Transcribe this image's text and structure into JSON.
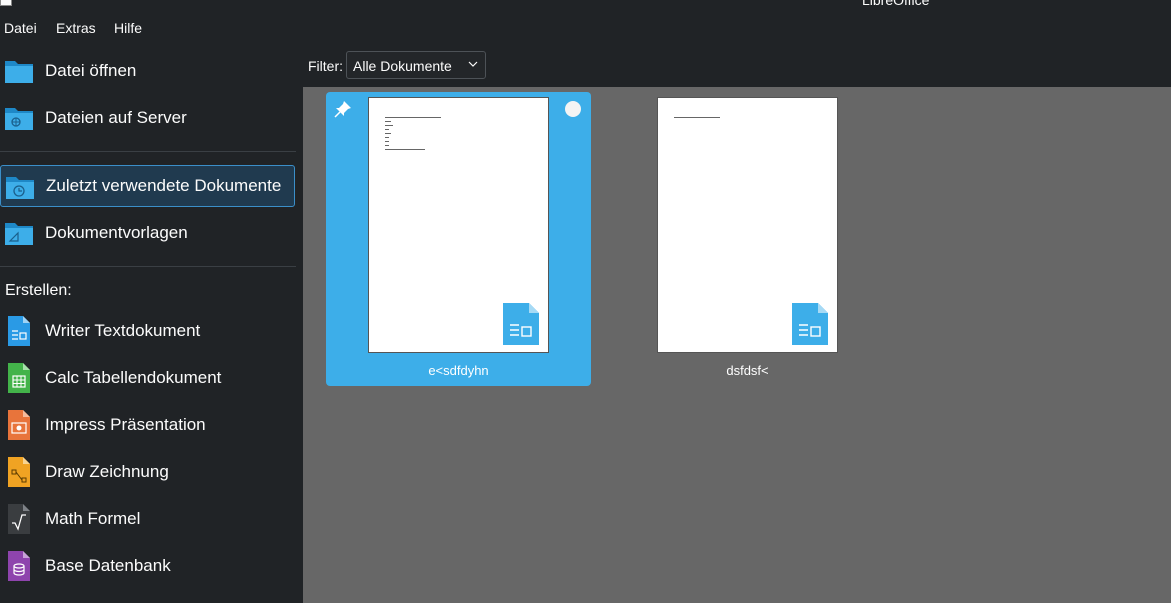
{
  "window": {
    "title": "LibreOffice"
  },
  "menubar": {
    "items": [
      "Datei",
      "Extras",
      "Hilfe"
    ]
  },
  "sidebar": {
    "nav": [
      {
        "label": "Datei öffnen",
        "icon": "folder-icon"
      },
      {
        "label": "Dateien auf Server",
        "icon": "folder-remote-icon"
      },
      {
        "label": "Zuletzt verwendete Dokumente",
        "icon": "folder-recent-icon",
        "active": true
      },
      {
        "label": "Dokumentvorlagen",
        "icon": "folder-templates-icon"
      }
    ],
    "create_heading": "Erstellen:",
    "create": [
      {
        "label": "Writer Textdokument",
        "icon": "writer-icon",
        "color": "#2a9ae5"
      },
      {
        "label": "Calc Tabellendokument",
        "icon": "calc-icon",
        "color": "#43b34a"
      },
      {
        "label": "Impress Präsentation",
        "icon": "impress-icon",
        "color": "#e8743b"
      },
      {
        "label": "Draw Zeichnung",
        "icon": "draw-icon",
        "color": "#f0a323"
      },
      {
        "label": "Math Formel",
        "icon": "math-icon",
        "color": "#3a3d40"
      },
      {
        "label": "Base Datenbank",
        "icon": "base-icon",
        "color": "#8e44ad"
      }
    ]
  },
  "filter": {
    "label": "Filter:",
    "value": "Alle Dokumente"
  },
  "documents": [
    {
      "name": "e<sdfdyhn",
      "selected": true
    },
    {
      "name": "dsfdsf<",
      "selected": false
    }
  ],
  "colors": {
    "accent": "#3daee9",
    "background": "#202326",
    "content_bg": "#676767"
  }
}
